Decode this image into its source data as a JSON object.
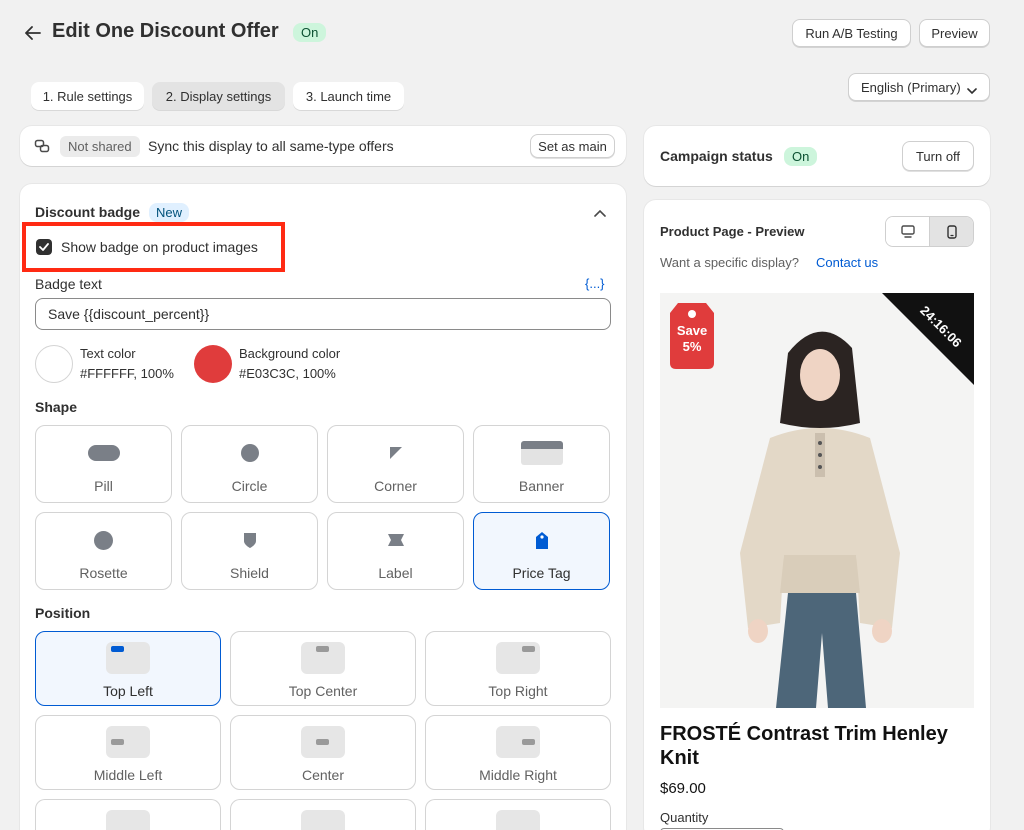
{
  "header": {
    "title": "Edit One Discount Offer",
    "status": "On",
    "ab_button": "Run A/B Testing",
    "preview_button": "Preview",
    "language": "English (Primary)"
  },
  "tabs": [
    {
      "label": "1. Rule settings"
    },
    {
      "label": "2. Display settings"
    },
    {
      "label": "3. Launch time"
    }
  ],
  "sync": {
    "shared_status": "Not shared",
    "text": "Sync this display to all same-type offers",
    "button": "Set as main"
  },
  "badge_section": {
    "title": "Discount badge",
    "new_label": "New",
    "checkbox_label": "Show badge on product images",
    "checkbox_checked": true,
    "badge_text_label": "Badge text",
    "variable_link": "{...}",
    "badge_text_value": "Save {{discount_percent}}",
    "text_color_label": "Text color",
    "text_color_value": "#FFFFFF, 100%",
    "text_color": "#FFFFFF",
    "bg_color_label": "Background color",
    "bg_color_value": "#E03C3C, 100%",
    "bg_color": "#E03C3C",
    "shape_title": "Shape",
    "shapes": [
      {
        "label": "Pill",
        "icon": "pill-shape-icon"
      },
      {
        "label": "Circle",
        "icon": "circle-shape-icon"
      },
      {
        "label": "Corner",
        "icon": "corner-shape-icon"
      },
      {
        "label": "Banner",
        "icon": "banner-shape-icon"
      },
      {
        "label": "Rosette",
        "icon": "rosette-shape-icon"
      },
      {
        "label": "Shield",
        "icon": "shield-shape-icon"
      },
      {
        "label": "Label",
        "icon": "label-shape-icon"
      },
      {
        "label": "Price Tag",
        "icon": "price-tag-shape-icon"
      }
    ],
    "selected_shape": "Price Tag",
    "position_title": "Position",
    "positions": [
      {
        "label": "Top Left"
      },
      {
        "label": "Top Center"
      },
      {
        "label": "Top Right"
      },
      {
        "label": "Middle Left"
      },
      {
        "label": "Center"
      },
      {
        "label": "Middle Right"
      }
    ],
    "selected_position": "Top Left"
  },
  "campaign": {
    "label": "Campaign status",
    "status": "On",
    "button": "Turn off"
  },
  "preview": {
    "title": "Product Page - Preview",
    "hint": "Want a specific display?",
    "contact_link": "Contact us",
    "badge_line1": "Save",
    "badge_line2": "5%",
    "countdown": "24:16:06",
    "product_name": "FROSTÉ Contrast Trim Henley Knit",
    "price": "$69.00",
    "quantity_label": "Quantity"
  },
  "colors": {
    "accent": "#005bd3",
    "badge_red": "#E03C3C",
    "on_green": "#cdf5dc"
  }
}
